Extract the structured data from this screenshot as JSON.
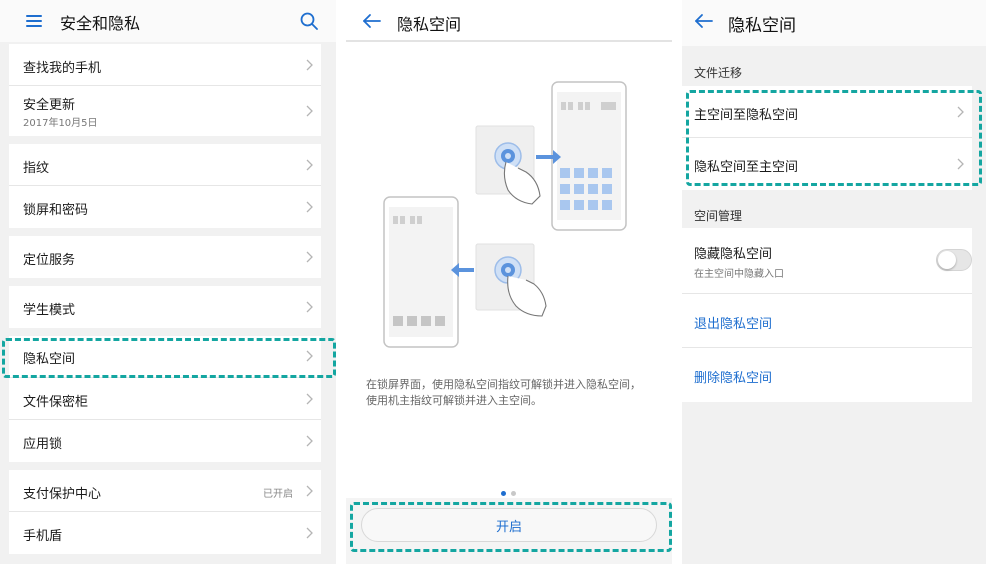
{
  "panel1": {
    "title": "安全和隐私",
    "groups": [
      {
        "rows": [
          {
            "label": "查找我的手机"
          },
          {
            "label": "安全更新",
            "sub": "2017年10月5日"
          }
        ]
      },
      {
        "rows": [
          {
            "label": "指纹"
          },
          {
            "label": "锁屏和密码"
          }
        ]
      },
      {
        "rows": [
          {
            "label": "定位服务"
          }
        ]
      },
      {
        "rows": [
          {
            "label": "学生模式"
          }
        ]
      },
      {
        "rows": [
          {
            "label": "隐私空间"
          },
          {
            "label": "文件保密柜"
          },
          {
            "label": "应用锁"
          }
        ]
      },
      {
        "rows": [
          {
            "label": "支付保护中心",
            "value": "已开启"
          },
          {
            "label": "手机盾"
          }
        ]
      }
    ]
  },
  "panel2": {
    "title": "隐私空间",
    "description": "在锁屏界面，使用隐私空间指纹可解锁并进入隐私空间，使用机主指纹可解锁并进入主空间。",
    "button_label": "开启"
  },
  "panel3": {
    "title": "隐私空间",
    "section1": {
      "label": "文件迁移",
      "items": [
        "主空间至隐私空间",
        "隐私空间至主空间"
      ]
    },
    "section2": {
      "label": "空间管理",
      "hide": {
        "label": "隐藏隐私空间",
        "sub": "在主空间中隐藏入口",
        "on": false
      },
      "exit_label": "退出隐私空间",
      "delete_label": "删除隐私空间"
    }
  },
  "colors": {
    "accent": "#1e6ecf",
    "highlight": "#14a6a1"
  },
  "icons": {
    "menu": "hamburger-icon",
    "search": "search-icon",
    "back": "back-arrow-icon",
    "chevron": "chevron-right-icon"
  }
}
